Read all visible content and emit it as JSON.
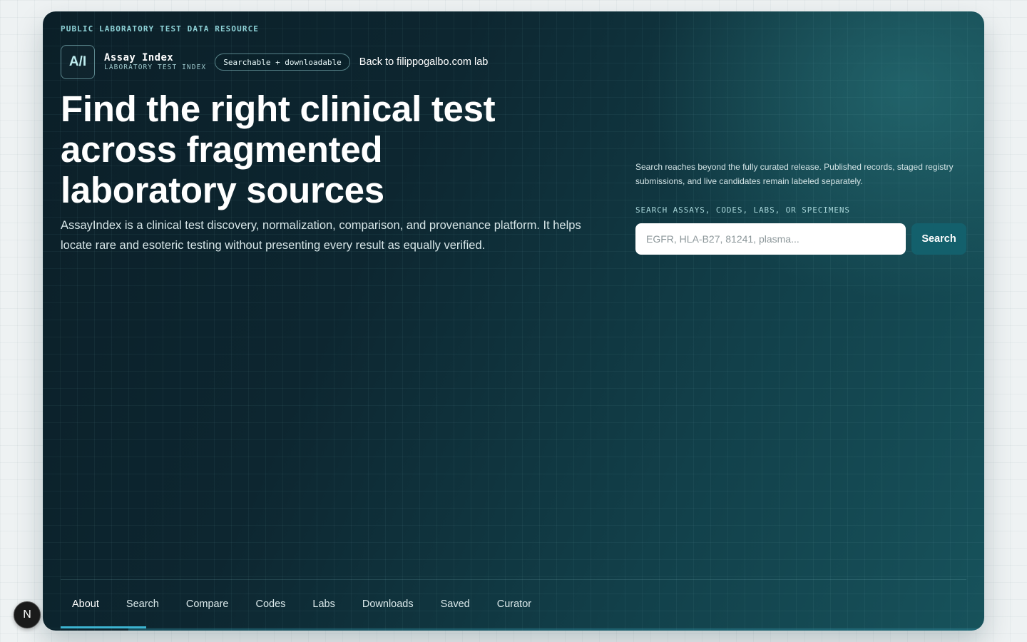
{
  "eyebrow": "PUBLIC LABORATORY TEST DATA RESOURCE",
  "brand": {
    "logo_text": "A/I",
    "name": "Assay Index",
    "subtitle": "LABORATORY TEST INDEX",
    "badge": "Searchable + downloadable",
    "back_link": "Back to filippogalbo.com lab"
  },
  "hero": {
    "headline": "Find the right clinical test across fragmented laboratory sources",
    "intro": "AssayIndex is a clinical test discovery, normalization, comparison, and provenance platform. It helps locate rare and esoteric testing without presenting every result as equally verified."
  },
  "search": {
    "note": "Search reaches beyond the fully curated release. Published records, staged registry submissions, and live candidates remain labeled separately.",
    "label": "SEARCH ASSAYS, CODES, LABS, OR SPECIMENS",
    "placeholder": "EGFR, HLA-B27, 81241, plasma...",
    "value": "",
    "button_label": "Search"
  },
  "nav": {
    "active": "About",
    "tabs": [
      {
        "label": "About"
      },
      {
        "label": "Search"
      },
      {
        "label": "Compare"
      },
      {
        "label": "Codes"
      },
      {
        "label": "Labs"
      },
      {
        "label": "Downloads"
      },
      {
        "label": "Saved"
      },
      {
        "label": "Curator"
      }
    ]
  },
  "dev_badge": {
    "letter": "N",
    "icon": "nextjs-icon"
  },
  "colors": {
    "accent": "#3cb3d0",
    "button": "#13606c",
    "panel_dark": "#0b1f28",
    "panel_light": "#17525b"
  }
}
